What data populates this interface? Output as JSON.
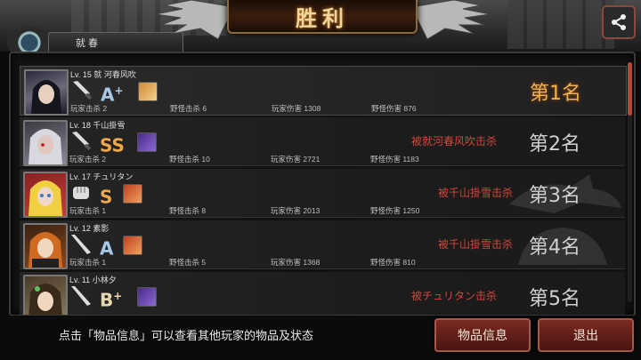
{
  "header": {
    "title": "胜利",
    "player_plate": "就 春"
  },
  "players": [
    {
      "level": "Lv. 15",
      "name": "就 河春风吹",
      "grade": "A",
      "grade_sup": "+",
      "grade_color": "#a8c8e8",
      "player_kills_label": "玩家击杀",
      "player_kills": "2",
      "monster_kills_label": "野怪击杀",
      "monster_kills": "6",
      "player_damage_label": "玩家伤害",
      "player_damage": "1308",
      "monster_damage_label": "野怪伤害",
      "monster_damage": "876",
      "killed_by": "",
      "rank": "第1名"
    },
    {
      "level": "Lv. 18",
      "name": "千山掛雪",
      "grade": "SS",
      "grade_sup": "",
      "grade_color": "#f0a64a",
      "player_kills_label": "玩家击杀",
      "player_kills": "2",
      "monster_kills_label": "野怪击杀",
      "monster_kills": "10",
      "player_damage_label": "玩家伤害",
      "player_damage": "2721",
      "monster_damage_label": "野怪伤害",
      "monster_damage": "1183",
      "killed_by": "被就河春风吹击杀",
      "rank": "第2名"
    },
    {
      "level": "Lv. 17",
      "name": "チュリタン",
      "grade": "S",
      "grade_sup": "",
      "grade_color": "#f0a64a",
      "player_kills_label": "玩家击杀",
      "player_kills": "1",
      "monster_kills_label": "野怪击杀",
      "monster_kills": "8",
      "player_damage_label": "玩家伤害",
      "player_damage": "2013",
      "monster_damage_label": "野怪伤害",
      "monster_damage": "1250",
      "killed_by": "被千山掛雪击杀",
      "rank": "第3名"
    },
    {
      "level": "Lv. 12",
      "name": "素影",
      "grade": "A",
      "grade_sup": "",
      "grade_color": "#a8c8e8",
      "player_kills_label": "玩家击杀",
      "player_kills": "1",
      "monster_kills_label": "野怪击杀",
      "monster_kills": "5",
      "player_damage_label": "玩家伤害",
      "player_damage": "1368",
      "monster_damage_label": "野怪伤害",
      "monster_damage": "810",
      "killed_by": "被千山掛雪击杀",
      "rank": "第4名"
    },
    {
      "level": "Lv. 11",
      "name": "小林夕",
      "grade": "B",
      "grade_sup": "+",
      "grade_color": "#e8d8b0",
      "player_kills_label": "",
      "player_kills": "",
      "monster_kills_label": "",
      "monster_kills": "",
      "player_damage_label": "",
      "player_damage": "",
      "monster_damage_label": "",
      "monster_damage": "",
      "killed_by": "被チュリタン击杀",
      "rank": "第5名"
    }
  ],
  "footer": {
    "hint": "点击「物品信息」可以查看其他玩家的物品及状态",
    "item_info_button": "物品信息",
    "exit_button": "退出"
  },
  "colors": {
    "accent_gold": "#f0b24a",
    "killer_red": "#d2463a",
    "button_red": "#7a2a22"
  }
}
